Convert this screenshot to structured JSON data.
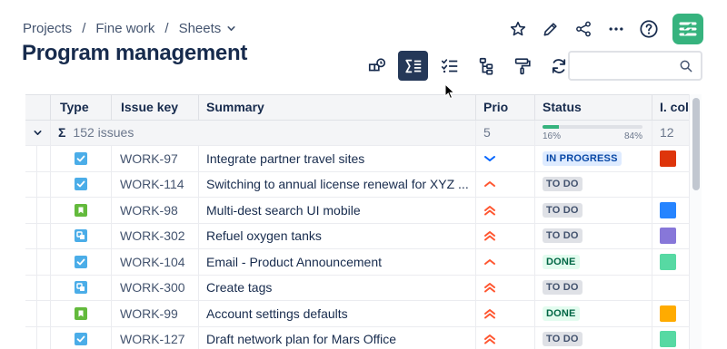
{
  "breadcrumb": {
    "items": [
      "Projects",
      "Fine work",
      "Sheets"
    ],
    "separator": "/"
  },
  "page": {
    "title": "Program management"
  },
  "search": {
    "placeholder": "",
    "value": ""
  },
  "table": {
    "headers": {
      "type": "Type",
      "key": "Issue key",
      "summary": "Summary",
      "prio": "Prio",
      "status": "Status",
      "col": "I. colo"
    },
    "summary_row": {
      "sigma": "Σ",
      "issues": "152 issues",
      "prio": "5",
      "progress_left": "16%",
      "progress_right": "84%",
      "progress_value": 16,
      "col": "12"
    },
    "rows": [
      {
        "type": "task",
        "key": "WORK-97",
        "summary": "Integrate partner travel sites",
        "prio": "low",
        "status": "IN PROGRESS",
        "status_kind": "inprogress",
        "color": "#de350b"
      },
      {
        "type": "task",
        "key": "WORK-114",
        "summary": "Switching to annual license renewal for XYZ ...",
        "prio": "medium",
        "status": "TO DO",
        "status_kind": "todo",
        "color": ""
      },
      {
        "type": "story",
        "key": "WORK-98",
        "summary": "Multi-dest search UI mobile",
        "prio": "high",
        "status": "TO DO",
        "status_kind": "todo",
        "color": "#2684ff"
      },
      {
        "type": "subtask",
        "key": "WORK-302",
        "summary": "Refuel oxygen tanks",
        "prio": "high",
        "status": "TO DO",
        "status_kind": "todo",
        "color": "#8777d9"
      },
      {
        "type": "task",
        "key": "WORK-104",
        "summary": "Email - Product Announcement",
        "prio": "medium",
        "status": "DONE",
        "status_kind": "done",
        "color": "#57d9a3"
      },
      {
        "type": "subtask",
        "key": "WORK-300",
        "summary": "Create tags",
        "prio": "high",
        "status": "TO DO",
        "status_kind": "todo",
        "color": ""
      },
      {
        "type": "story",
        "key": "WORK-99",
        "summary": "Account settings defaults",
        "prio": "high",
        "status": "DONE",
        "status_kind": "done",
        "color": "#ffab00"
      },
      {
        "type": "task",
        "key": "WORK-127",
        "summary": "Draft network plan for Mars Office",
        "prio": "high",
        "status": "TO DO",
        "status_kind": "todo",
        "color": "#57d9a3"
      }
    ]
  },
  "colors": {
    "accent": "#253858",
    "task": "#4bade8",
    "story": "#63ba3c",
    "prio_low": "#0065ff",
    "prio_high": "#ff5630",
    "logo": "#36b37e"
  }
}
